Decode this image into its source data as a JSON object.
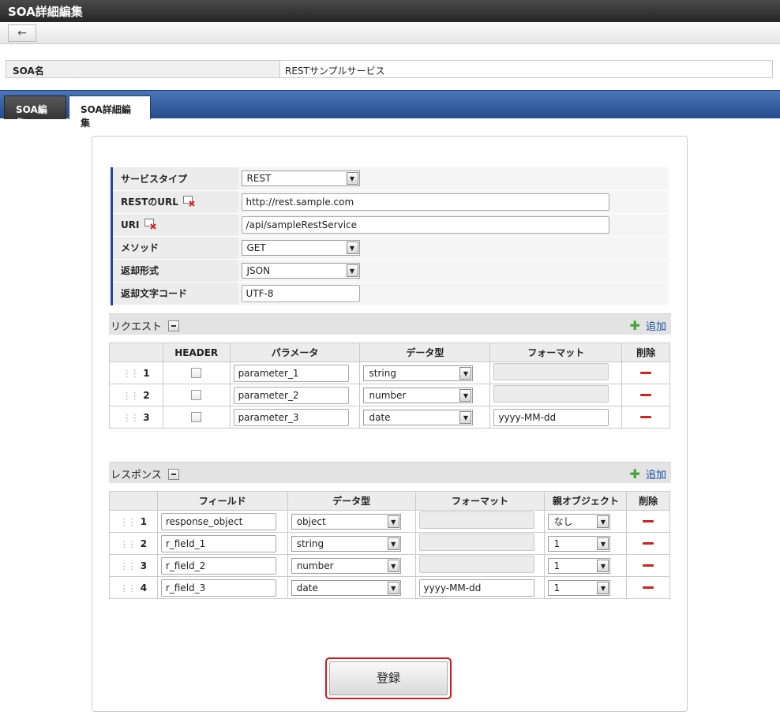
{
  "window_title": "SOA詳細編集",
  "toolbar": {
    "back_icon": "←"
  },
  "soa_name": {
    "label": "SOA名",
    "value": "RESTサンプルサービス"
  },
  "tabs": [
    {
      "label": "SOA編集"
    },
    {
      "label": "SOA詳細編集"
    }
  ],
  "form": {
    "service_type": {
      "label": "サービスタイプ",
      "value": "REST"
    },
    "rest_url": {
      "label": "RESTのURL",
      "value": "http://rest.sample.com"
    },
    "uri": {
      "label": "URI",
      "value": "/api/sampleRestService"
    },
    "method": {
      "label": "メソッド",
      "value": "GET"
    },
    "return_format": {
      "label": "返却形式",
      "value": "JSON"
    },
    "return_charset": {
      "label": "返却文字コード",
      "value": "UTF-8"
    }
  },
  "request": {
    "title": "リクエスト",
    "add_label": "追加",
    "columns": [
      "HEADER",
      "パラメータ",
      "データ型",
      "フォーマット",
      "削除"
    ],
    "rows": [
      {
        "num": "1",
        "param": "parameter_1",
        "type": "string",
        "format": ""
      },
      {
        "num": "2",
        "param": "parameter_2",
        "type": "number",
        "format": ""
      },
      {
        "num": "3",
        "param": "parameter_3",
        "type": "date",
        "format": "yyyy-MM-dd"
      }
    ]
  },
  "response": {
    "title": "レスポンス",
    "add_label": "追加",
    "columns": [
      "フィールド",
      "データ型",
      "フォーマット",
      "親オブジェクト",
      "削除"
    ],
    "rows": [
      {
        "num": "1",
        "field": "response_object",
        "type": "object",
        "format": "",
        "parent": "なし"
      },
      {
        "num": "2",
        "field": "r_field_1",
        "type": "string",
        "format": "",
        "parent": "1"
      },
      {
        "num": "3",
        "field": "r_field_2",
        "type": "number",
        "format": "",
        "parent": "1"
      },
      {
        "num": "4",
        "field": "r_field_3",
        "type": "date",
        "format": "yyyy-MM-dd",
        "parent": "1"
      }
    ]
  },
  "submit_label": "登録",
  "colors": {
    "accent_blue": "#2a559a",
    "highlight_red": "#cc1d1d",
    "add_green": "#3ea534"
  }
}
